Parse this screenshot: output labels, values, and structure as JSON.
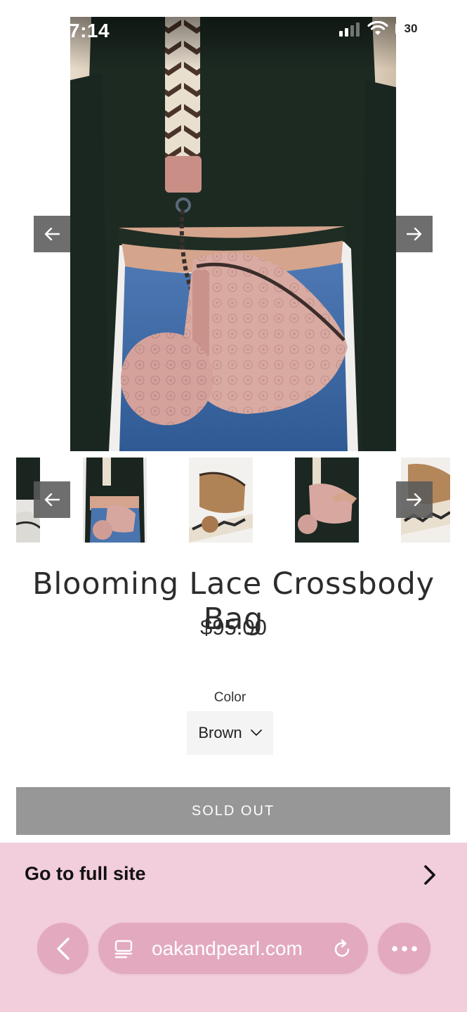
{
  "status_bar": {
    "time": "7:14",
    "battery": "30",
    "battery_level": 0.3
  },
  "product": {
    "title": "Blooming Lace Crossbody Bag",
    "price": "$95.00",
    "option_label": "Color",
    "selected_color": "Brown",
    "button_label": "SOLD OUT"
  },
  "gallery": {
    "thumbnails": [
      "black-leather-bag",
      "pink-bag-model",
      "brown-bag-product",
      "pink-bag-hand",
      "brown-bag-strap"
    ]
  },
  "banner": {
    "label": "Go to full site"
  },
  "browser": {
    "url": "oakandpearl.com"
  },
  "icons": {
    "prev": "arrow-left-icon",
    "next": "arrow-right-icon",
    "dropdown": "chevron-down-icon",
    "full_site": "chevron-right-icon",
    "back": "chevron-left-icon",
    "tab": "tab-layout-icon",
    "reload": "reload-icon",
    "more": "more-dots-icon"
  },
  "colors": {
    "sold_out_bg": "#979797",
    "banner_bg": "#f2cddc",
    "browser_controls": "#e3a9bf",
    "nav_button": "#5a5a5a"
  }
}
